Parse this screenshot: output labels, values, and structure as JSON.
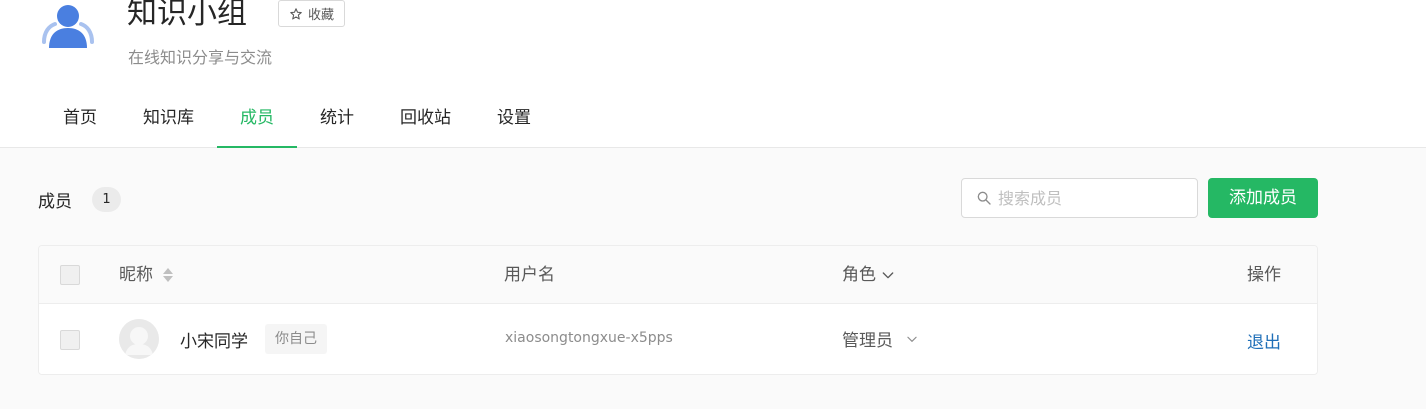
{
  "group": {
    "title": "知识小组",
    "description": "在线知识分享与交流",
    "favorite_label": "收藏"
  },
  "tabs": [
    {
      "label": "首页",
      "active": false
    },
    {
      "label": "知识库",
      "active": false
    },
    {
      "label": "成员",
      "active": true
    },
    {
      "label": "统计",
      "active": false
    },
    {
      "label": "回收站",
      "active": false
    },
    {
      "label": "设置",
      "active": false
    }
  ],
  "members": {
    "label": "成员",
    "count": "1",
    "search_placeholder": "搜索成员",
    "add_button_label": "添加成员",
    "columns": {
      "nickname": "昵称",
      "username": "用户名",
      "role": "角色",
      "operations": "操作"
    },
    "rows": [
      {
        "nickname": "小宋同学",
        "tag": "你自己",
        "username": "xiaosongtongxue-x5pps",
        "role": "管理员",
        "action": "退出"
      }
    ]
  },
  "icons": {
    "group_avatar": "group-people-icon",
    "favorite": "star-icon",
    "search": "search-icon",
    "sort": "sort-icon",
    "role_filter": "chevron-down-icon"
  },
  "colors": {
    "accent": "#25b864",
    "link": "#1f6fb8",
    "avatar_blue": "#4a7fe0"
  }
}
